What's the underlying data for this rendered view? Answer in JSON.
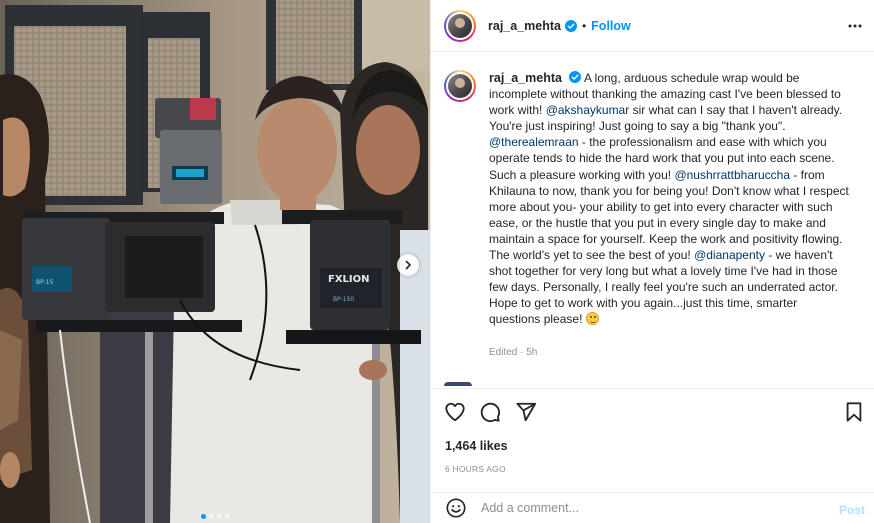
{
  "post": {
    "username": "raj_a_mehta",
    "verified_icon": "verified-badge-icon",
    "bullet": "•",
    "follow_label": "Follow",
    "more_icon": "more-options-icon"
  },
  "media": {
    "alt_icon": "photo",
    "next_icon": "chevron-right-icon",
    "slides": 4,
    "active_slide": 1,
    "brand_text_1": "FXLION",
    "brand_text_2": "BP-15",
    "brand_text_3": "BP-150"
  },
  "caption": {
    "username": "raj_a_mehta",
    "part1": " A long, arduous schedule wrap would be incomplete without thanking the amazing cast I've been blessed to work with! ",
    "mention1": "@akshaykumar",
    "part2": " sir what can I say that I haven't already. You're just inspiring! Just going to say a big \"thank you\". ",
    "mention2": "@therealemraan",
    "part3": " - the professionalism and ease with which you operate tends to hide the hard work that you put into each scene. Such a pleasure working with you! ",
    "mention3": "@nushrrattbharuccha",
    "part4": " - from Khilauna to now, thank you for being you! Don't know what I respect more about you- your ability to get into every character with such ease, or the hustle that you put in every single day to make and maintain a space for yourself. Keep the work and positivity flowing. The world's yet to see the best of you! ",
    "mention4": "@dianapenty",
    "part5": " - we haven't shot together for very long but what a lovely time I've had in those few days. Personally, I really feel you're such an underrated actor. Hope to get to work with you again...just this time, smarter questions please! ",
    "emoji_icon": "smiling-face-emoji-icon",
    "edited": "Edited · 5h"
  },
  "actions": {
    "like_icon": "heart-icon",
    "comment_icon": "comment-icon",
    "share_icon": "send-icon",
    "save_icon": "bookmark-icon",
    "likes": "1,464 likes",
    "time": "6 HOURS AGO"
  },
  "comment_box": {
    "emoji_icon": "smiley-icon",
    "placeholder": "Add a comment...",
    "post_label": "Post"
  },
  "colors": {
    "link": "#0095f6",
    "mention": "#00376b",
    "muted": "#8e8e8e",
    "post_disabled": "#b2dffc"
  }
}
